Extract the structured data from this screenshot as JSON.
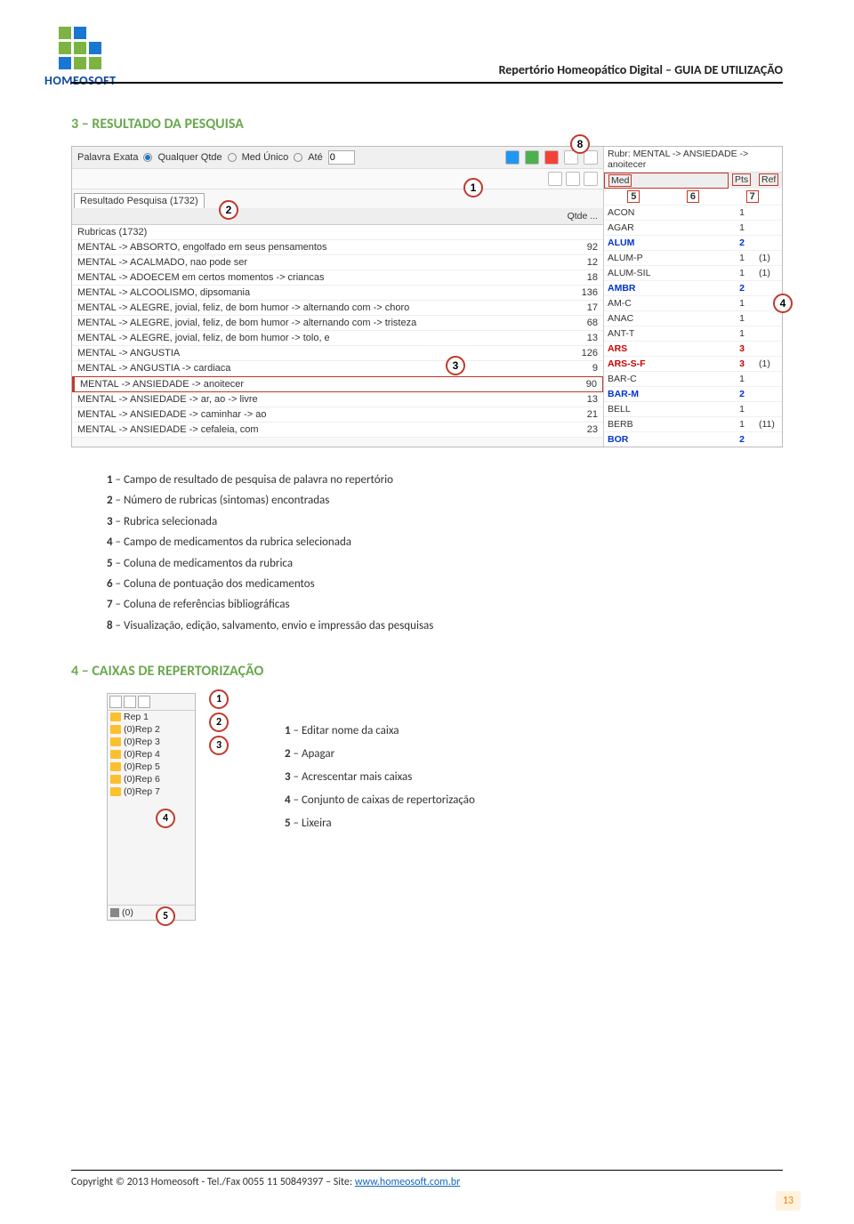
{
  "logo_text": "HOMEOSOFT",
  "header": "Repertório Homeopático Digital – GUIA DE UTILIZAÇÃO",
  "section3_title": "3 – RESULTADO DA PESQUISA",
  "toolbar": {
    "palavra_exata": "Palavra Exata",
    "qualquer_qtde": "Qualquer Qtde",
    "med_unico": "Med Único",
    "ate": "Até",
    "ate_val": "0"
  },
  "result_tab": "Resultado Pesquisa (1732)",
  "qtde_label": "Qtde ...",
  "result_rows": [
    {
      "t": "Rubricas (1732)",
      "q": ""
    },
    {
      "t": "MENTAL -> ABSORTO, engolfado em seus pensamentos",
      "q": "92"
    },
    {
      "t": "MENTAL -> ACALMADO, nao pode ser",
      "q": "12"
    },
    {
      "t": "MENTAL -> ADOECEM em certos momentos -> criancas",
      "q": "18"
    },
    {
      "t": "MENTAL -> ALCOOLISMO, dipsomania",
      "q": "136"
    },
    {
      "t": "MENTAL -> ALEGRE, jovial, feliz, de bom humor -> alternando com -> choro",
      "q": "17"
    },
    {
      "t": "MENTAL -> ALEGRE, jovial, feliz, de bom humor -> alternando com -> tristeza",
      "q": "68"
    },
    {
      "t": "MENTAL -> ALEGRE, jovial, feliz, de bom humor -> tolo, e",
      "q": "13"
    },
    {
      "t": "MENTAL -> ANGUSTIA",
      "q": "126"
    },
    {
      "t": "MENTAL -> ANGUSTIA -> cardiaca",
      "q": "9"
    },
    {
      "t": "MENTAL -> ANSIEDADE -> anoitecer",
      "q": "90",
      "sel": true
    },
    {
      "t": "MENTAL -> ANSIEDADE -> ar, ao -> livre",
      "q": "13"
    },
    {
      "t": "MENTAL -> ANSIEDADE -> caminhar -> ao",
      "q": "21"
    },
    {
      "t": "MENTAL -> ANSIEDADE -> cefaleia, com",
      "q": "23"
    }
  ],
  "rubr_line": "Rubr: MENTAL -> ANSIEDADE -> anoitecer",
  "med_cols": {
    "a": "Med",
    "b": "Pts",
    "c": "Ref"
  },
  "meds": [
    {
      "n": "ACON",
      "p": "1",
      "r": "",
      "cls": ""
    },
    {
      "n": "AGAR",
      "p": "1",
      "r": "",
      "cls": ""
    },
    {
      "n": "ALUM",
      "p": "2",
      "r": "",
      "cls": "bold-blue"
    },
    {
      "n": "ALUM-P",
      "p": "1",
      "r": "(1)",
      "cls": ""
    },
    {
      "n": "ALUM-SIL",
      "p": "1",
      "r": "(1)",
      "cls": ""
    },
    {
      "n": "AMBR",
      "p": "2",
      "r": "",
      "cls": "bold-blue"
    },
    {
      "n": "AM-C",
      "p": "1",
      "r": "",
      "cls": ""
    },
    {
      "n": "ANAC",
      "p": "1",
      "r": "",
      "cls": ""
    },
    {
      "n": "ANT-T",
      "p": "1",
      "r": "",
      "cls": ""
    },
    {
      "n": "ARS",
      "p": "3",
      "r": "",
      "cls": "bold-red"
    },
    {
      "n": "ARS-S-F",
      "p": "3",
      "r": "(1)",
      "cls": "bold-red"
    },
    {
      "n": "BAR-C",
      "p": "1",
      "r": "",
      "cls": ""
    },
    {
      "n": "BAR-M",
      "p": "2",
      "r": "",
      "cls": "bold-blue"
    },
    {
      "n": "BELL",
      "p": "1",
      "r": "",
      "cls": ""
    },
    {
      "n": "BERB",
      "p": "1",
      "r": "(11)",
      "cls": ""
    },
    {
      "n": "BOR",
      "p": "2",
      "r": "",
      "cls": "bold-blue"
    }
  ],
  "callouts": {
    "c1": "1",
    "c2": "2",
    "c3": "3",
    "c4": "4",
    "c5": "5",
    "c6": "6",
    "c7": "7",
    "c8": "8"
  },
  "legend3": [
    "1 – Campo de resultado de pesquisa de palavra no repertório",
    "2 – Número de rubricas (sintomas) encontradas",
    "3 – Rubrica selecionada",
    "4 – Campo de medicamentos da rubrica selecionada",
    "5 – Coluna de medicamentos da rubrica",
    "6 – Coluna de pontuação dos medicamentos",
    "7 – Coluna de referências bibliográficas",
    "8 – Visualização, edição, salvamento, envio e impressão das pesquisas"
  ],
  "section4_title": "4 – CAIXAS DE REPERTORIZAÇÃO",
  "rep_items": [
    "Rep 1",
    "(0)Rep 2",
    "(0)Rep 3",
    "(0)Rep 4",
    "(0)Rep 5",
    "(0)Rep 6",
    "(0)Rep 7"
  ],
  "rep_bottom": "(0)",
  "legend4": [
    "1 – Editar nome da caixa",
    "2 – Apagar",
    "3 – Acrescentar mais caixas",
    "4 – Conjunto de caixas de repertorização",
    "5 – Lixeira"
  ],
  "rep_callouts": {
    "c1": "1",
    "c2": "2",
    "c3": "3",
    "c4": "4",
    "c5": "5"
  },
  "footer_text": "Copyright © 2013  Homeosoft - Tel./Fax 0055 11 50849397 – Site: ",
  "footer_link": "www.homeosoft.com.br",
  "page_num": "13"
}
